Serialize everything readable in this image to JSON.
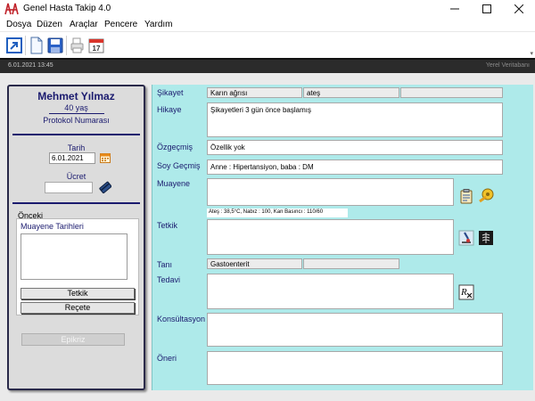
{
  "window": {
    "title": "Genel Hasta Takip 4.0",
    "minimize_icon": "minimize-icon",
    "maximize_icon": "maximize-icon",
    "close_icon": "close-icon"
  },
  "menu": {
    "items": [
      "Dosya",
      "Düzen",
      "Araçlar",
      "Pencere",
      "Yardım"
    ]
  },
  "toolbar": {
    "icons": [
      "open-icon",
      "new-document-icon",
      "save-icon",
      "print-icon",
      "calendar-icon"
    ],
    "calendar_day": "17"
  },
  "status": {
    "date": "6.01.2021 13:45",
    "database": "Yerel Veritabanı"
  },
  "patient": {
    "name": "Mehmet Yılmaz",
    "age": "40 yaş",
    "protocol_label": "Protokol Numarası",
    "date_label": "Tarih",
    "date_value": "6.01.2021",
    "fee_label": "Ücret",
    "fee_value": "",
    "previous_label": "Önceki",
    "exam_dates_label": "Muayene Tarihleri",
    "tetkik_button": "Tetkik",
    "recete_button": "Reçete",
    "epikriz_button": "Epikriz"
  },
  "form": {
    "sikayet_label": "Şikayet",
    "sikayet_values": [
      "Karın ağrısı",
      "ateş",
      ""
    ],
    "hikaye_label": "Hikaye",
    "hikaye_value": "Şikayetleri 3 gün önce başlamış",
    "ozgecmis_label": "Özgeçmiş",
    "ozgecmis_value": "Özellik yok",
    "soygecmis_label": "Soy Geçmiş",
    "soygecmis_value": "Anne : Hipertansiyon, baba : DM",
    "muayene_label": "Muayene",
    "muayene_value": "",
    "vitals": "Ateş : 38,5°C, Nabız : 100, Kan Basıncı : 110/60",
    "tetkik_label": "Tetkik",
    "tetkik_value": "",
    "tani_label": "Tanı",
    "tani_values": [
      "Gastoenterit",
      ""
    ],
    "tedavi_label": "Tedavi",
    "tedavi_value": "",
    "konsultasyon_label": "Konsültasyon",
    "konsultasyon_value": "",
    "oneri_label": "Öneri",
    "oneri_value": ""
  },
  "colors": {
    "right_panel_bg": "#aeeaea",
    "label_color": "#1a1a6e",
    "status_bar_bg": "#2b2b2b"
  }
}
